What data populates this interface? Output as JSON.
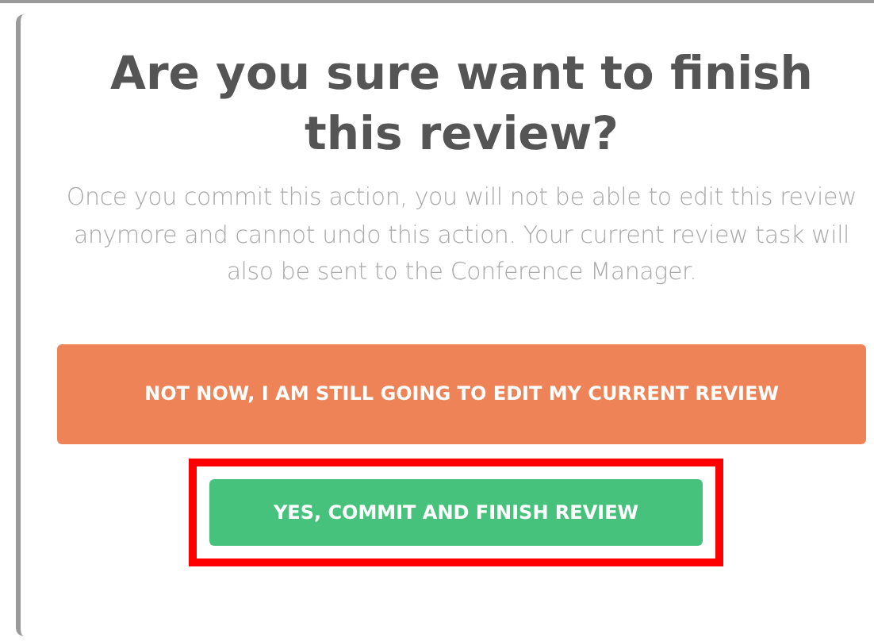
{
  "dialog": {
    "title": "Are you sure want to finish this review?",
    "message": "Once you commit this action, you will not be able to edit this review anymore and cannot undo this action. Your current review task will also be sent to the Conference Manager.",
    "buttons": [
      {
        "label": "NOT NOW, I AM STILL GOING TO EDIT MY CURRENT REVIEW",
        "kind": "cancel",
        "highlighted": false
      },
      {
        "label": "YES, COMMIT AND FINISH REVIEW",
        "kind": "confirm",
        "highlighted": true
      }
    ]
  }
}
